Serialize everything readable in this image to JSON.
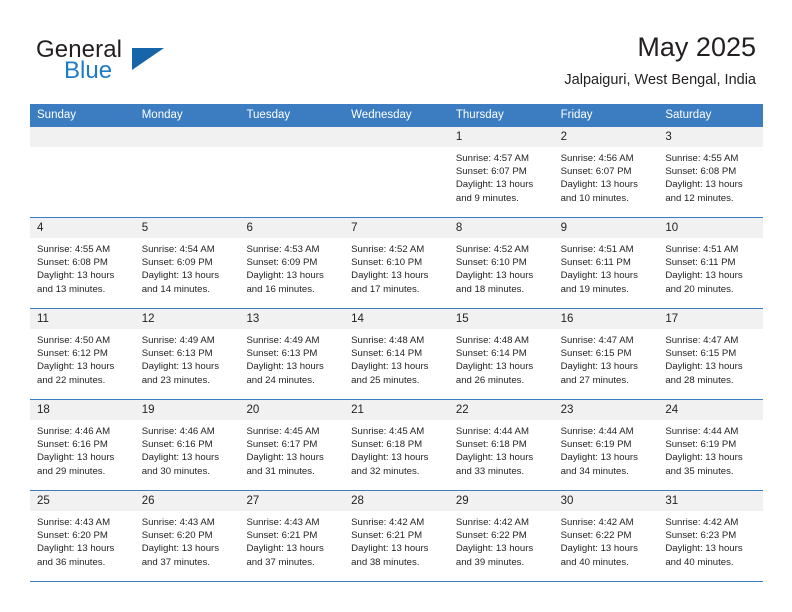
{
  "brand": {
    "word1": "General",
    "word2": "Blue",
    "flag_icon": "triangle-flag-icon",
    "accent_hex": "#1e7bc8"
  },
  "header": {
    "title": "May 2025",
    "subtitle": "Jalpaiguri, West Bengal, India"
  },
  "theme": {
    "header_band_hex": "#3b7dc0",
    "day_number_band_hex": "#f1f1f1",
    "text_hex": "#231f20"
  },
  "weekdays": [
    "Sunday",
    "Monday",
    "Tuesday",
    "Wednesday",
    "Thursday",
    "Friday",
    "Saturday"
  ],
  "weeks": [
    [
      {
        "day": "",
        "lines": [
          "",
          "",
          "",
          ""
        ]
      },
      {
        "day": "",
        "lines": [
          "",
          "",
          "",
          ""
        ]
      },
      {
        "day": "",
        "lines": [
          "",
          "",
          "",
          ""
        ]
      },
      {
        "day": "",
        "lines": [
          "",
          "",
          "",
          ""
        ]
      },
      {
        "day": "1",
        "lines": [
          "Sunrise: 4:57 AM",
          "Sunset: 6:07 PM",
          "Daylight: 13 hours",
          "and 9 minutes."
        ]
      },
      {
        "day": "2",
        "lines": [
          "Sunrise: 4:56 AM",
          "Sunset: 6:07 PM",
          "Daylight: 13 hours",
          "and 10 minutes."
        ]
      },
      {
        "day": "3",
        "lines": [
          "Sunrise: 4:55 AM",
          "Sunset: 6:08 PM",
          "Daylight: 13 hours",
          "and 12 minutes."
        ]
      }
    ],
    [
      {
        "day": "4",
        "lines": [
          "Sunrise: 4:55 AM",
          "Sunset: 6:08 PM",
          "Daylight: 13 hours",
          "and 13 minutes."
        ]
      },
      {
        "day": "5",
        "lines": [
          "Sunrise: 4:54 AM",
          "Sunset: 6:09 PM",
          "Daylight: 13 hours",
          "and 14 minutes."
        ]
      },
      {
        "day": "6",
        "lines": [
          "Sunrise: 4:53 AM",
          "Sunset: 6:09 PM",
          "Daylight: 13 hours",
          "and 16 minutes."
        ]
      },
      {
        "day": "7",
        "lines": [
          "Sunrise: 4:52 AM",
          "Sunset: 6:10 PM",
          "Daylight: 13 hours",
          "and 17 minutes."
        ]
      },
      {
        "day": "8",
        "lines": [
          "Sunrise: 4:52 AM",
          "Sunset: 6:10 PM",
          "Daylight: 13 hours",
          "and 18 minutes."
        ]
      },
      {
        "day": "9",
        "lines": [
          "Sunrise: 4:51 AM",
          "Sunset: 6:11 PM",
          "Daylight: 13 hours",
          "and 19 minutes."
        ]
      },
      {
        "day": "10",
        "lines": [
          "Sunrise: 4:51 AM",
          "Sunset: 6:11 PM",
          "Daylight: 13 hours",
          "and 20 minutes."
        ]
      }
    ],
    [
      {
        "day": "11",
        "lines": [
          "Sunrise: 4:50 AM",
          "Sunset: 6:12 PM",
          "Daylight: 13 hours",
          "and 22 minutes."
        ]
      },
      {
        "day": "12",
        "lines": [
          "Sunrise: 4:49 AM",
          "Sunset: 6:13 PM",
          "Daylight: 13 hours",
          "and 23 minutes."
        ]
      },
      {
        "day": "13",
        "lines": [
          "Sunrise: 4:49 AM",
          "Sunset: 6:13 PM",
          "Daylight: 13 hours",
          "and 24 minutes."
        ]
      },
      {
        "day": "14",
        "lines": [
          "Sunrise: 4:48 AM",
          "Sunset: 6:14 PM",
          "Daylight: 13 hours",
          "and 25 minutes."
        ]
      },
      {
        "day": "15",
        "lines": [
          "Sunrise: 4:48 AM",
          "Sunset: 6:14 PM",
          "Daylight: 13 hours",
          "and 26 minutes."
        ]
      },
      {
        "day": "16",
        "lines": [
          "Sunrise: 4:47 AM",
          "Sunset: 6:15 PM",
          "Daylight: 13 hours",
          "and 27 minutes."
        ]
      },
      {
        "day": "17",
        "lines": [
          "Sunrise: 4:47 AM",
          "Sunset: 6:15 PM",
          "Daylight: 13 hours",
          "and 28 minutes."
        ]
      }
    ],
    [
      {
        "day": "18",
        "lines": [
          "Sunrise: 4:46 AM",
          "Sunset: 6:16 PM",
          "Daylight: 13 hours",
          "and 29 minutes."
        ]
      },
      {
        "day": "19",
        "lines": [
          "Sunrise: 4:46 AM",
          "Sunset: 6:16 PM",
          "Daylight: 13 hours",
          "and 30 minutes."
        ]
      },
      {
        "day": "20",
        "lines": [
          "Sunrise: 4:45 AM",
          "Sunset: 6:17 PM",
          "Daylight: 13 hours",
          "and 31 minutes."
        ]
      },
      {
        "day": "21",
        "lines": [
          "Sunrise: 4:45 AM",
          "Sunset: 6:18 PM",
          "Daylight: 13 hours",
          "and 32 minutes."
        ]
      },
      {
        "day": "22",
        "lines": [
          "Sunrise: 4:44 AM",
          "Sunset: 6:18 PM",
          "Daylight: 13 hours",
          "and 33 minutes."
        ]
      },
      {
        "day": "23",
        "lines": [
          "Sunrise: 4:44 AM",
          "Sunset: 6:19 PM",
          "Daylight: 13 hours",
          "and 34 minutes."
        ]
      },
      {
        "day": "24",
        "lines": [
          "Sunrise: 4:44 AM",
          "Sunset: 6:19 PM",
          "Daylight: 13 hours",
          "and 35 minutes."
        ]
      }
    ],
    [
      {
        "day": "25",
        "lines": [
          "Sunrise: 4:43 AM",
          "Sunset: 6:20 PM",
          "Daylight: 13 hours",
          "and 36 minutes."
        ]
      },
      {
        "day": "26",
        "lines": [
          "Sunrise: 4:43 AM",
          "Sunset: 6:20 PM",
          "Daylight: 13 hours",
          "and 37 minutes."
        ]
      },
      {
        "day": "27",
        "lines": [
          "Sunrise: 4:43 AM",
          "Sunset: 6:21 PM",
          "Daylight: 13 hours",
          "and 37 minutes."
        ]
      },
      {
        "day": "28",
        "lines": [
          "Sunrise: 4:42 AM",
          "Sunset: 6:21 PM",
          "Daylight: 13 hours",
          "and 38 minutes."
        ]
      },
      {
        "day": "29",
        "lines": [
          "Sunrise: 4:42 AM",
          "Sunset: 6:22 PM",
          "Daylight: 13 hours",
          "and 39 minutes."
        ]
      },
      {
        "day": "30",
        "lines": [
          "Sunrise: 4:42 AM",
          "Sunset: 6:22 PM",
          "Daylight: 13 hours",
          "and 40 minutes."
        ]
      },
      {
        "day": "31",
        "lines": [
          "Sunrise: 4:42 AM",
          "Sunset: 6:23 PM",
          "Daylight: 13 hours",
          "and 40 minutes."
        ]
      }
    ]
  ]
}
